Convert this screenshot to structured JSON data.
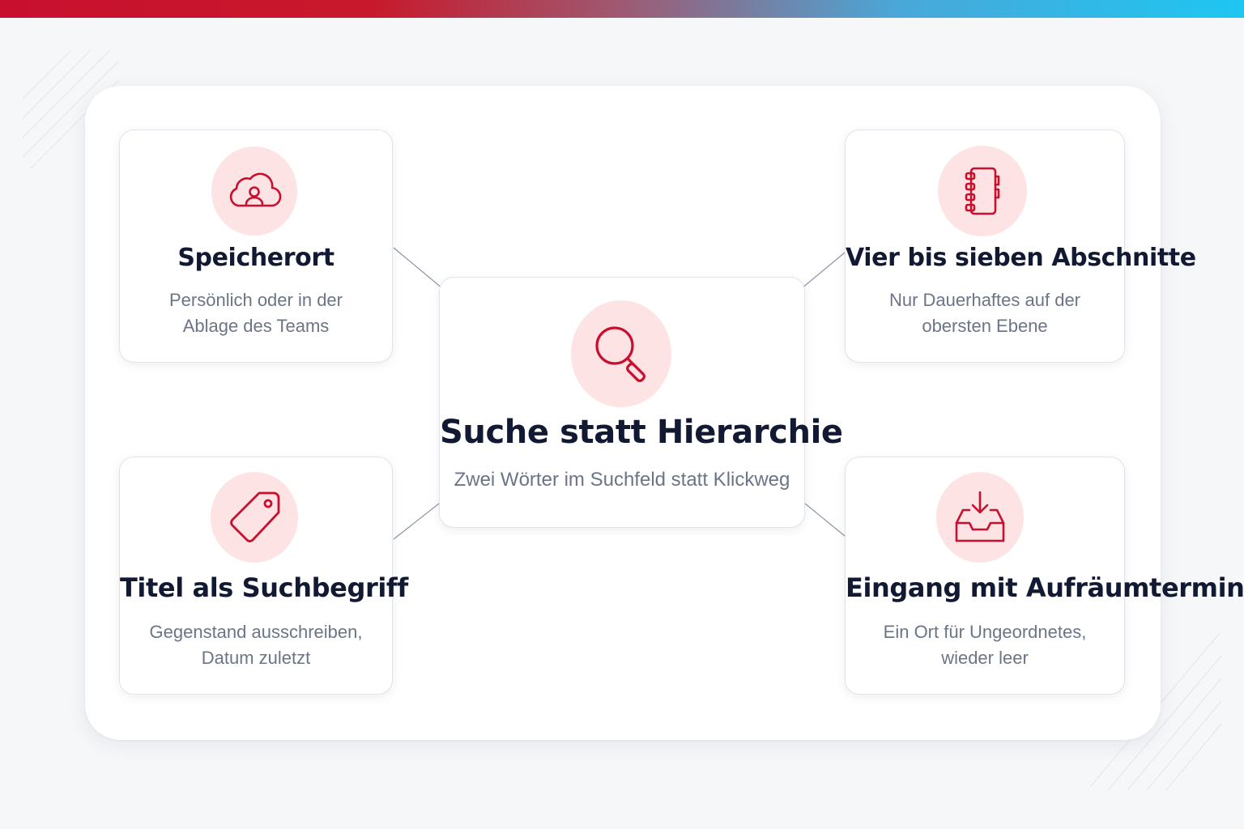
{
  "colors": {
    "accent_red": "#c8102e",
    "accent_blue": "#1ec6f2",
    "icon_background": "#fde3e4",
    "title_text": "#121a33",
    "description_text": "#6b7587"
  },
  "center": {
    "icon": "search-icon",
    "title": "Suche statt Hierarchie",
    "desc": "Zwei Wörter im Suchfeld statt Klickweg"
  },
  "cards": [
    {
      "icon": "cloud-user-icon",
      "title": "Speicherort",
      "desc": [
        "Persönlich oder in der",
        "Ablage des Teams"
      ]
    },
    {
      "icon": "notebook-icon",
      "title": "Vier bis sieben Abschnitte",
      "desc": [
        "Nur Dauerhaftes auf der",
        "obersten Ebene"
      ]
    },
    {
      "icon": "tag-icon",
      "title": "Titel als Suchbegriff",
      "desc": [
        "Gegenstand ausschreiben,",
        "Datum zuletzt"
      ]
    },
    {
      "icon": "inbox-download-icon",
      "title": "Eingang mit Aufräumtermin",
      "desc": [
        "Ein Ort für Ungeordnetes,",
        "wieder leer"
      ]
    }
  ]
}
